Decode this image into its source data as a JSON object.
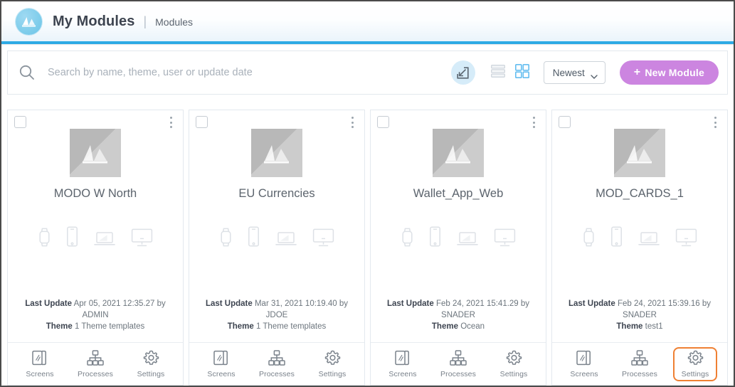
{
  "header": {
    "logo_icon": "mountain-logo-icon",
    "title": "My Modules",
    "separator": "|",
    "breadcrumb": "Modules",
    "accent_color": "#2eaae4"
  },
  "toolbar": {
    "search_icon": "search-icon",
    "search_value": "",
    "search_placeholder": "Search by name, theme, user or update date",
    "export_icon": "import-export-icon",
    "list_view_icon": "list-view-icon",
    "grid_view_icon": "grid-view-icon",
    "active_view": "grid",
    "sort_label": "Newest",
    "sort_chevron_icon": "chevron-down-icon",
    "new_module_plus": "+",
    "new_module_label": "New Module",
    "new_module_color": "#cc85e0"
  },
  "card_labels": {
    "last_update": "Last Update",
    "theme": "Theme",
    "screens": "Screens",
    "processes": "Processes",
    "settings": "Settings"
  },
  "highlight_color": "#ef8033",
  "cards": [
    {
      "title": "MODO W North",
      "last_update": "Apr 05, 2021 12:35.27 by ADMIN",
      "theme": "1 Theme templates",
      "devices": [
        "watch-icon",
        "phone-icon",
        "laptop-icon",
        "desktop-icon"
      ],
      "highlighted_footer": null
    },
    {
      "title": "EU Currencies",
      "last_update": "Mar 31, 2021 10:19.40 by JDOE",
      "theme": "1 Theme templates",
      "devices": [
        "watch-icon",
        "phone-icon",
        "laptop-icon",
        "desktop-icon"
      ],
      "highlighted_footer": null
    },
    {
      "title": "Wallet_App_Web",
      "last_update": "Feb 24, 2021 15:41.29 by SNADER",
      "theme": "Ocean",
      "devices": [
        "watch-icon",
        "phone-icon",
        "laptop-icon",
        "desktop-icon"
      ],
      "highlighted_footer": null
    },
    {
      "title": "MOD_CARDS_1",
      "last_update": "Feb 24, 2021 15:39.16 by SNADER",
      "theme": "test1",
      "devices": [
        "watch-icon",
        "phone-icon",
        "laptop-icon",
        "desktop-icon"
      ],
      "highlighted_footer": "settings"
    }
  ]
}
